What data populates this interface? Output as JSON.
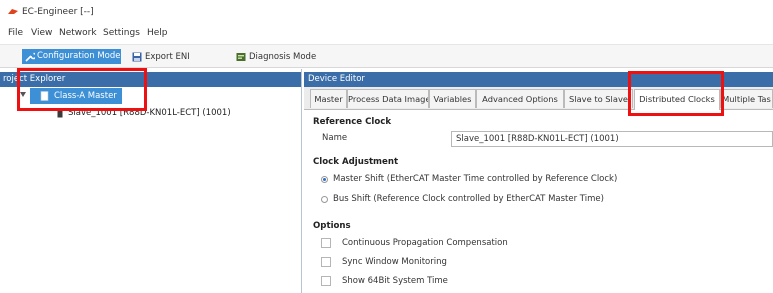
{
  "window": {
    "title": "EC-Engineer [--]"
  },
  "menu": [
    "File",
    "View",
    "Network",
    "Settings",
    "Help"
  ],
  "toolbar": {
    "configuration_mode": "Configuration Mode",
    "export_eni": "Export ENI",
    "diagnosis_mode": "Diagnosis Mode"
  },
  "left_pane": {
    "header": "roject Explorer",
    "tree": {
      "root": "Class-A Master",
      "child": "Slave_1001 [R88D-KN01L-ECT] (1001)"
    }
  },
  "right_pane": {
    "header": "Device Editor",
    "tabs": [
      "Master",
      "Process Data Image",
      "Variables",
      "Advanced Options",
      "Slave to Slave",
      "Distributed Clocks",
      "Multiple Tas"
    ],
    "active_tab": "Distributed Clocks",
    "reference_clock": {
      "title": "Reference Clock",
      "name_label": "Name",
      "name_value": "Slave_1001 [R88D-KN01L-ECT] (1001)"
    },
    "clock_adjustment": {
      "title": "Clock Adjustment",
      "options": [
        {
          "label": "Master Shift (EtherCAT Master Time controlled by Reference Clock)",
          "selected": true
        },
        {
          "label": "Bus Shift (Reference Clock controlled by EtherCAT Master Time)",
          "selected": false
        }
      ]
    },
    "options": {
      "title": "Options",
      "items": [
        {
          "label": "Continuous Propagation Compensation",
          "checked": false
        },
        {
          "label": "Sync Window Monitoring",
          "checked": false
        },
        {
          "label": "Show 64Bit System Time",
          "checked": false
        }
      ]
    }
  },
  "colors": {
    "accent": "#3d8fd6",
    "header": "#3b6ea8",
    "highlight": "#ee1111"
  }
}
